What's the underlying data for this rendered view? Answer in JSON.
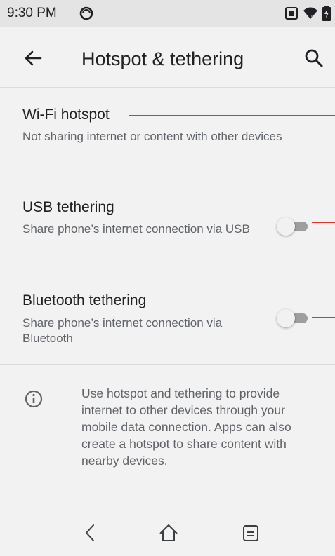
{
  "status_bar": {
    "time": "9:30 PM",
    "left_icons": [
      "data-saver-icon"
    ],
    "right_icons": [
      "screenshot-icon",
      "wifi-icon",
      "battery-icon"
    ]
  },
  "app_bar": {
    "title": "Hotspot & tethering",
    "back_icon": "arrow-back-icon",
    "search_icon": "search-icon"
  },
  "settings": [
    {
      "title": "Wi-Fi hotspot",
      "subtitle": "Not sharing internet or content with other devices",
      "has_toggle": false
    },
    {
      "title": "USB tethering",
      "subtitle": "Share phone’s internet connection via USB",
      "has_toggle": true,
      "toggle_on": false
    },
    {
      "title": "Bluetooth tethering",
      "subtitle": "Share phone’s internet connection via Bluetooth",
      "has_toggle": true,
      "toggle_on": false
    }
  ],
  "info": {
    "icon": "info-icon",
    "text": "Use hotspot and tethering to provide internet to other devices through your mobile data connection. Apps can also create a hotspot to share content with nearby devices."
  },
  "nav_bar": {
    "icons": [
      "nav-back-icon",
      "nav-home-icon",
      "nav-recents-icon"
    ]
  },
  "colors": {
    "background": "#f2f2f2",
    "status_bar": "#e4e4e4",
    "annotation_line": "#e0342c",
    "toggle_off_track": "#9e9e9e"
  }
}
